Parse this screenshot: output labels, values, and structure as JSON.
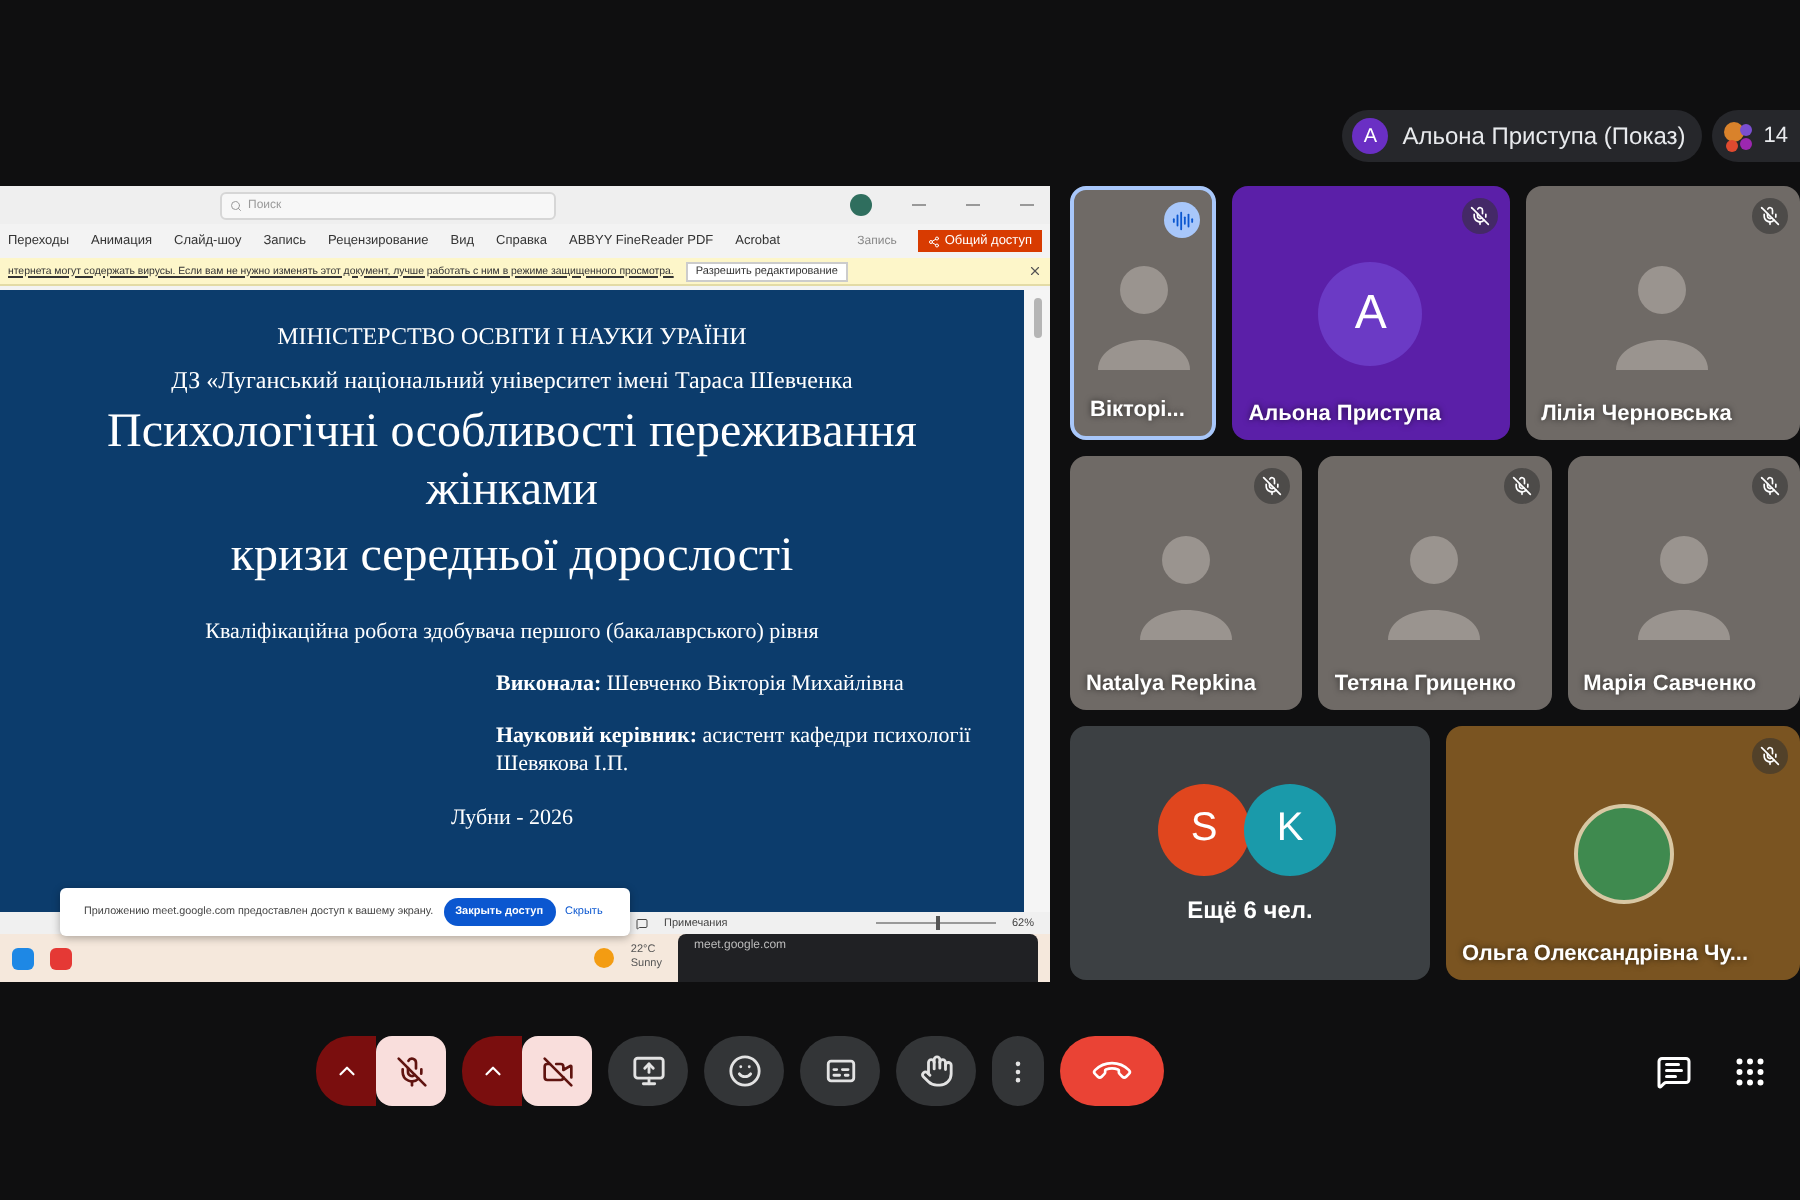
{
  "presenter_chip": {
    "initial": "A",
    "label": "Альона Приступа (Показ)"
  },
  "participants_count": "14",
  "shared_screen": {
    "search": {
      "placeholder": "Поиск"
    },
    "ribbon_tabs": [
      "Переходы",
      "Анимация",
      "Слайд-шоу",
      "Запись",
      "Рецензирование",
      "Вид",
      "Справка",
      "ABBYY FineReader PDF",
      "Acrobat"
    ],
    "record_button": "Запись",
    "share_button": "Общий доступ",
    "protected_view": {
      "message": "нтернета могут содержать вирусы. Если вам не нужно изменять этот документ, лучше работать с ним в режиме защищенного просмотра.",
      "button": "Разрешить редактирование"
    },
    "slide": {
      "lines": [
        {
          "kind": "small",
          "text": "МІНІСТЕРСТВО ОСВІТИ І НАУКИ УРАЇНИ"
        },
        {
          "kind": "small",
          "text": "ДЗ «Луганський національний університет імені Тараса Шевченка"
        },
        {
          "kind": "title",
          "text": "Психологічні особливості переживання жінками"
        },
        {
          "kind": "title",
          "text": "кризи середньої дорослості"
        },
        {
          "kind": "note",
          "text": "Кваліфікаційна робота здобувача першого (бакалаврського) рівня"
        },
        {
          "kind": "signature",
          "text": "**Виконала:** Шевченко Вікторія Михайлівна"
        },
        {
          "kind": "signature",
          "text": "**Науковий керівник:** асистент кафедри психології Шевякова І.П."
        },
        {
          "kind": "footer",
          "text": "Лубни - 2026"
        }
      ]
    },
    "share_notice": {
      "message": "Приложению meet.google.com предоставлен доступ к вашему экрану.",
      "stop_button": "Закрыть доступ",
      "hide_link": "Скрыть"
    },
    "status_bar": {
      "notes": "Примечания",
      "zoom": "62%",
      "level": 0.5
    },
    "taskbar": {
      "temperature": "22°C",
      "weather": "Sunny",
      "popup_url": "meet.google.com"
    }
  },
  "tile_rows": [
    {
      "tiles": [
        {
          "kind": "video",
          "name": "Вікторі...",
          "speaking": true,
          "muted": false
        },
        {
          "kind": "avatar",
          "name": "Альона Приступа",
          "initial": "A",
          "speaking": false,
          "muted": true
        },
        {
          "kind": "video",
          "name": "Лілія Черновська",
          "speaking": false,
          "muted": true
        }
      ]
    },
    {
      "tiles": [
        {
          "kind": "video",
          "name": "Natalya Repkina",
          "speaking": false,
          "muted": true
        },
        {
          "kind": "video",
          "name": "Тетяна Гриценко",
          "speaking": false,
          "muted": true
        },
        {
          "kind": "video",
          "name": "Марія Савченко",
          "speaking": false,
          "muted": true
        }
      ]
    },
    {
      "tiles": [
        {
          "kind": "others",
          "label": "Ещё 6 чел.",
          "avatars": [
            {
              "initial": "S",
              "color": "#e0461e"
            },
            {
              "initial": "K",
              "color": "#1a9aaa"
            }
          ]
        },
        {
          "kind": "photo-avatar",
          "name": "Ольга Олександрівна Чу...",
          "speaking": false,
          "muted": true
        }
      ]
    }
  ],
  "toolbar": {
    "mic_on": false,
    "camera_on": false
  }
}
